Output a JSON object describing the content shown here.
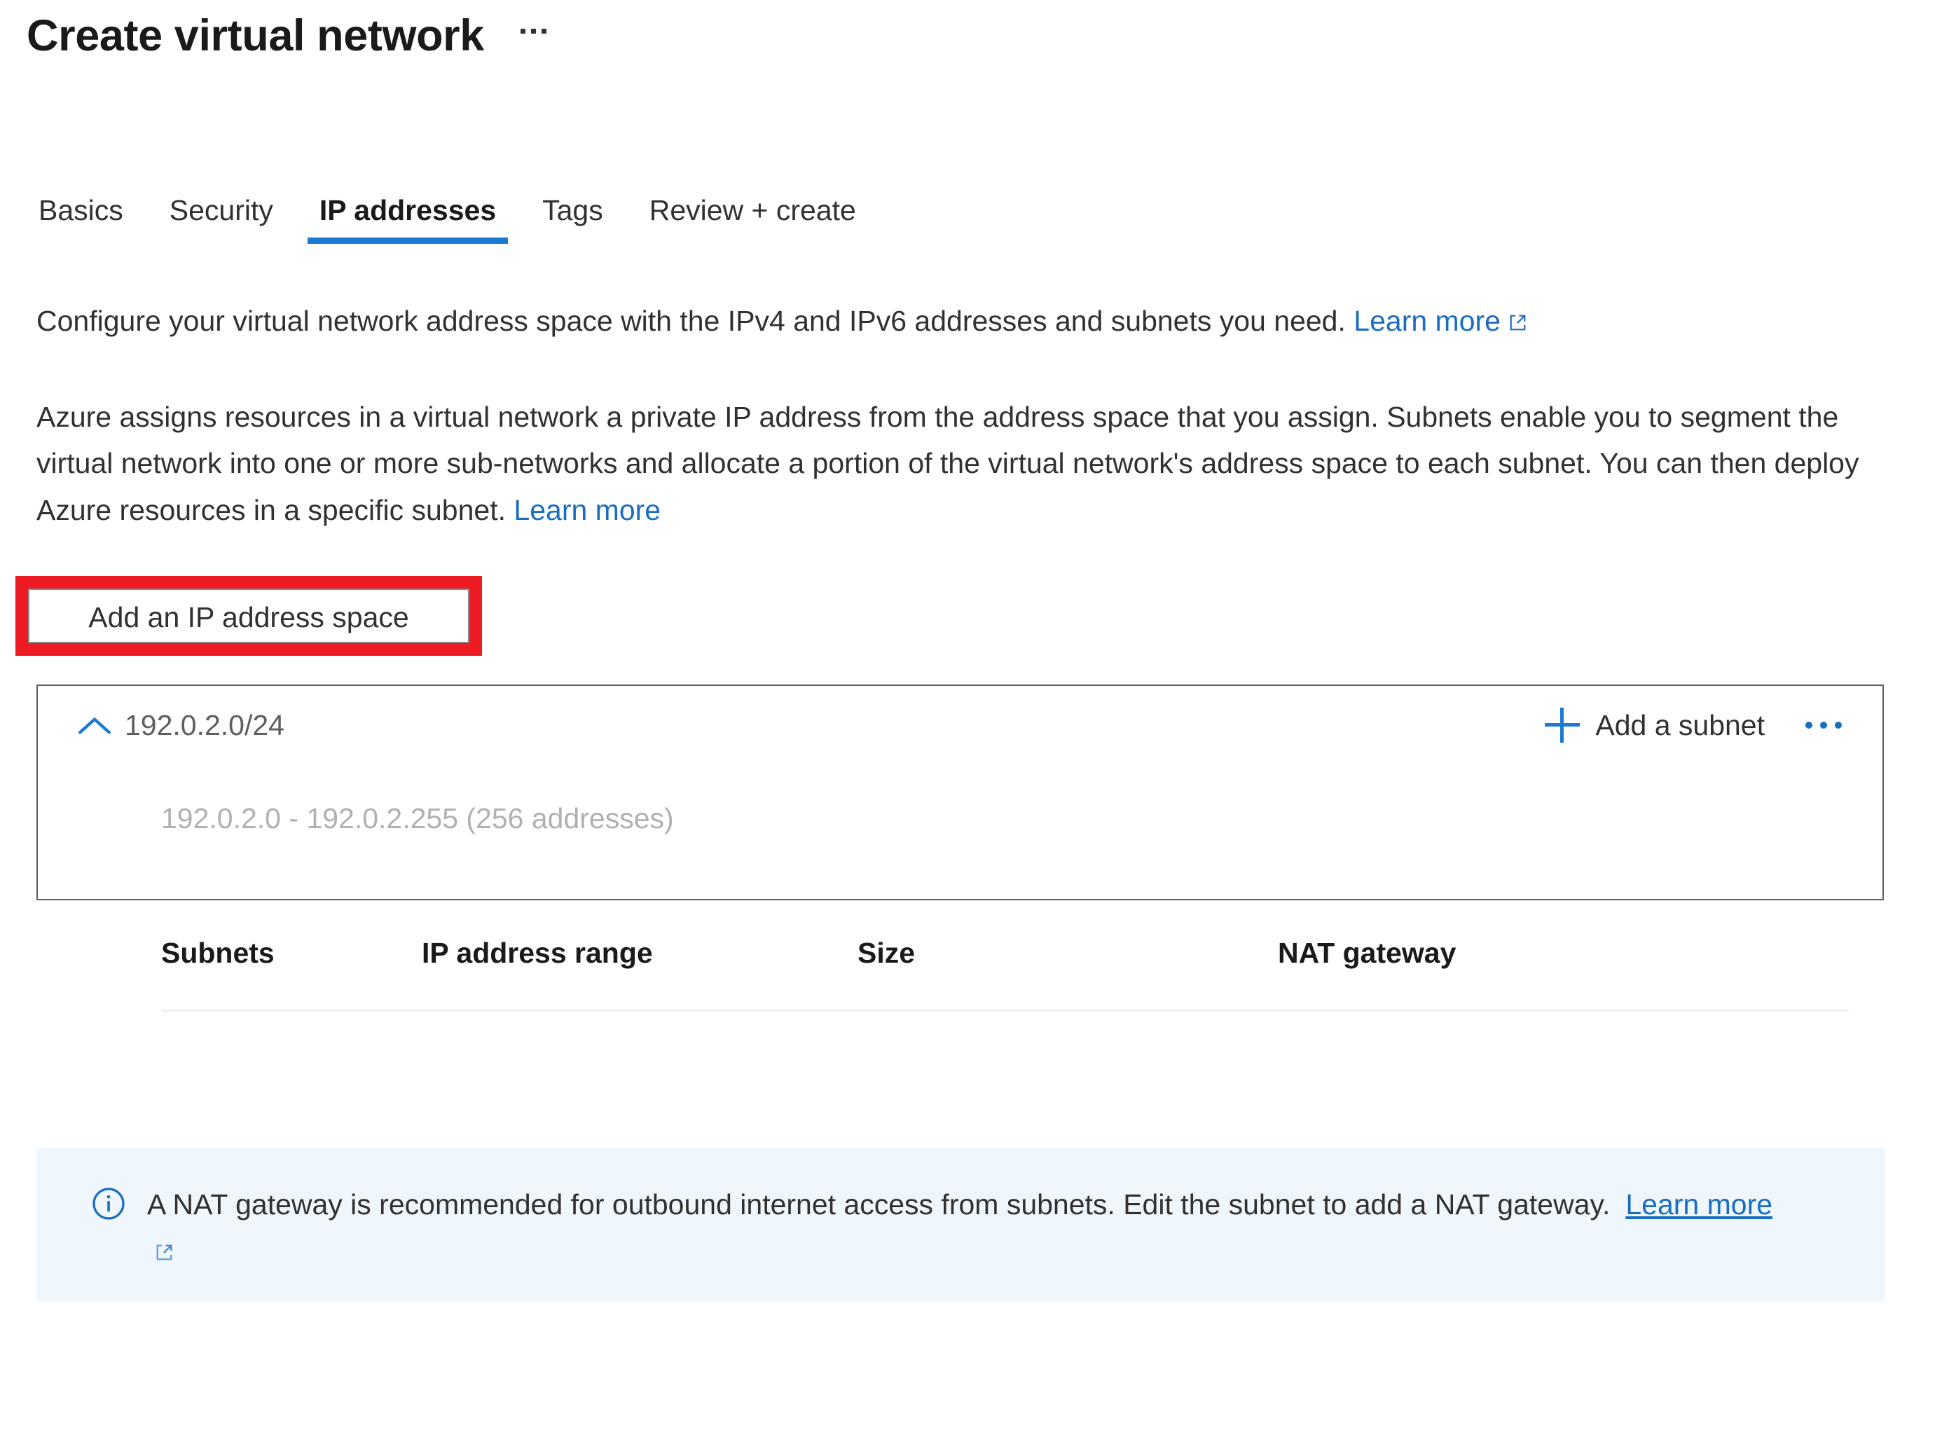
{
  "header": {
    "title": "Create virtual network",
    "more_menu_icon": "ellipsis-icon"
  },
  "tabs": [
    {
      "label": "Basics",
      "active": false
    },
    {
      "label": "Security",
      "active": false
    },
    {
      "label": "IP addresses",
      "active": true
    },
    {
      "label": "Tags",
      "active": false
    },
    {
      "label": "Review + create",
      "active": false
    }
  ],
  "content": {
    "intro_text": "Configure your virtual network address space with the IPv4 and IPv6 addresses and subnets you need.",
    "intro_link": "Learn more",
    "intro_link_icon": "external-link-icon",
    "paragraph_text": "Azure assigns resources in a virtual network a private IP address from the address space that you assign. Subnets enable you to segment the virtual network into one or more sub-networks and allocate a portion of the virtual network's address space to each subnet. You can then deploy Azure resources in a specific subnet.",
    "paragraph_link": "Learn more",
    "add_address_space_button": "Add an IP address space"
  },
  "address_space_card": {
    "collapse_icon": "chevron-up-icon",
    "cidr": "192.0.2.0/24",
    "range_summary": "192.0.2.0 - 192.0.2.255 (256 addresses)",
    "add_subnet_label": "Add a subnet",
    "add_subnet_icon": "plus-icon",
    "overflow_icon": "ellipsis-icon",
    "table": {
      "columns": [
        "Subnets",
        "IP address range",
        "Size",
        "NAT gateway"
      ],
      "rows": []
    }
  },
  "info_banner": {
    "icon": "info-circle-icon",
    "text": "A NAT gateway is recommended for outbound internet access from subnets. Edit the subnet to add a NAT gateway.",
    "link": "Learn more",
    "link_icon": "external-link-icon"
  },
  "colors": {
    "accent_blue": "#1a7ad4",
    "link_blue": "#1a6dc0",
    "banner_bg": "#eff6fc",
    "highlight_red": "#ee1b24",
    "text_primary": "#323130",
    "text_muted": "#605e5c",
    "text_faint": "#b3b0ad"
  }
}
